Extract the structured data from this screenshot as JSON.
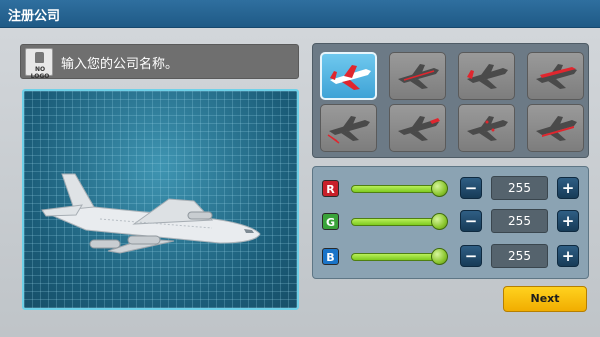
{
  "window": {
    "title": "注册公司"
  },
  "company": {
    "logo_text": "NO LOGO",
    "name_placeholder": "输入您的公司名称。"
  },
  "liveries": [
    {
      "icon": "airplane-livery-red-wing",
      "selected": true
    },
    {
      "icon": "airplane-livery-red-stripe",
      "selected": false
    },
    {
      "icon": "airplane-livery-red-tail",
      "selected": false
    },
    {
      "icon": "airplane-livery-red-top",
      "selected": false
    },
    {
      "icon": "airplane-livery-red-tail-fin",
      "selected": false
    },
    {
      "icon": "airplane-livery-red-nose",
      "selected": false
    },
    {
      "icon": "airplane-livery-red-dots",
      "selected": false
    },
    {
      "icon": "airplane-livery-red-belly",
      "selected": false
    }
  ],
  "color": {
    "rows": [
      {
        "label": "R",
        "value": "255",
        "chip_color": "#c8202a"
      },
      {
        "label": "G",
        "value": "255",
        "chip_color": "#3aa33a"
      },
      {
        "label": "B",
        "value": "255",
        "chip_color": "#1a74c8"
      }
    ],
    "minus_symbol": "−",
    "plus_symbol": "+"
  },
  "actions": {
    "next_label": "Next"
  }
}
